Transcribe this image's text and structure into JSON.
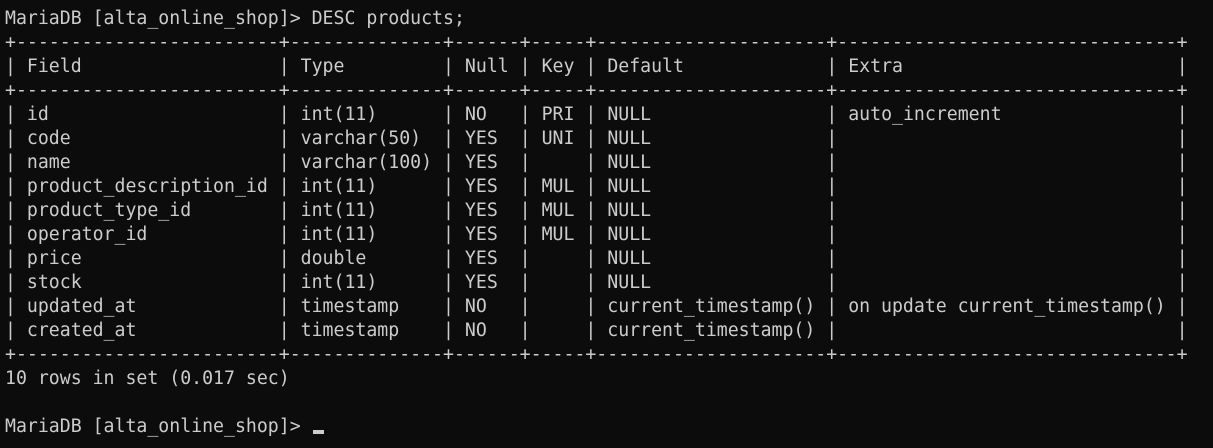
{
  "prompt": "MariaDB [alta_online_shop]>",
  "command": "DESC products;",
  "table": {
    "columns": [
      "Field",
      "Type",
      "Null",
      "Key",
      "Default",
      "Extra"
    ],
    "rows": [
      [
        "id",
        "int(11)",
        "NO",
        "PRI",
        "NULL",
        "auto_increment"
      ],
      [
        "code",
        "varchar(50)",
        "YES",
        "UNI",
        "NULL",
        ""
      ],
      [
        "name",
        "varchar(100)",
        "YES",
        "",
        "NULL",
        ""
      ],
      [
        "product_description_id",
        "int(11)",
        "YES",
        "MUL",
        "NULL",
        ""
      ],
      [
        "product_type_id",
        "int(11)",
        "YES",
        "MUL",
        "NULL",
        ""
      ],
      [
        "operator_id",
        "int(11)",
        "YES",
        "MUL",
        "NULL",
        ""
      ],
      [
        "price",
        "double",
        "YES",
        "",
        "NULL",
        ""
      ],
      [
        "stock",
        "int(11)",
        "YES",
        "",
        "NULL",
        ""
      ],
      [
        "updated_at",
        "timestamp",
        "NO",
        "",
        "current_timestamp()",
        "on update current_timestamp()"
      ],
      [
        "created_at",
        "timestamp",
        "NO",
        "",
        "current_timestamp()",
        ""
      ]
    ]
  },
  "result_summary": "10 rows in set (0.017 sec)",
  "colors": {
    "background": "#0c0c0c",
    "text": "#cccccc"
  }
}
